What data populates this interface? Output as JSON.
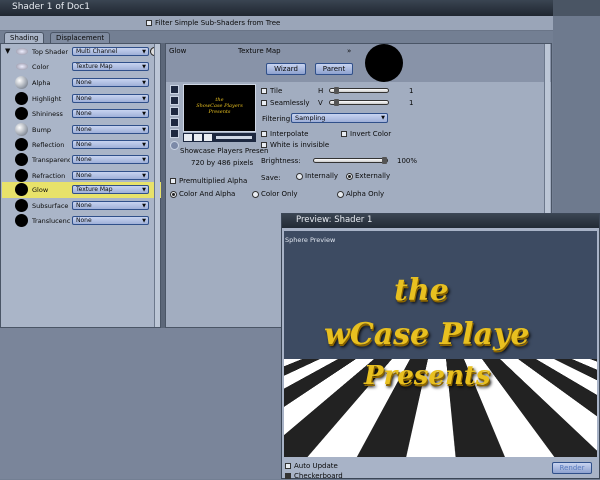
{
  "window": {
    "title": "Shader 1 of Doc1"
  },
  "toolbar": {
    "filter_label": "Filter Simple Sub-Shaders from Tree"
  },
  "tabs": [
    {
      "label": "Shading"
    },
    {
      "label": "Displacement"
    }
  ],
  "channels": [
    {
      "label": "Top Shader",
      "value": "Multi Channel"
    },
    {
      "label": "Color",
      "value": "Texture Map"
    },
    {
      "label": "Alpha",
      "value": "None"
    },
    {
      "label": "Highlight",
      "value": "None"
    },
    {
      "label": "Shininess",
      "value": "None"
    },
    {
      "label": "Bump",
      "value": "None"
    },
    {
      "label": "Reflection",
      "value": "None"
    },
    {
      "label": "Transparency",
      "value": "None"
    },
    {
      "label": "Refraction",
      "value": "None"
    },
    {
      "label": "Glow",
      "value": "Texture Map"
    },
    {
      "label": "Subsurface Sc",
      "value": "None"
    },
    {
      "label": "Translucency",
      "value": "None"
    }
  ],
  "right": {
    "channel_name": "Glow",
    "shader_type": "Texture Map",
    "wizard": "Wizard",
    "parent": "Parent",
    "thumb_text": [
      "the",
      "ShowCase Players",
      "Presents"
    ],
    "image_name": "Showcase Players Presen",
    "image_size": "720 by 486 pixels",
    "tile": {
      "label": "Tile",
      "axis": "H",
      "value": "1"
    },
    "seamless": {
      "label": "Seamlessly",
      "axis": "V",
      "value": "1"
    },
    "filtering": {
      "label": "Filtering:",
      "value": "Sampling"
    },
    "interpolate": "Interpolate",
    "invert": "Invert Color",
    "white_invisible": "White is invisible",
    "brightness": {
      "label": "Brightness:",
      "value": "100%",
      "level": 1.0
    },
    "save": {
      "label": "Save:",
      "opt1": "Internally",
      "opt2": "Externally"
    },
    "premult": "Premultiplied Alpha",
    "modes": [
      "Color And Alpha",
      "Color Only",
      "Alpha Only"
    ]
  },
  "preview": {
    "title": "Preview: Shader 1",
    "area_label": "Sphere Preview",
    "text_lines": [
      "the",
      "wCase Playe",
      "Presents"
    ],
    "auto_update": "Auto Update",
    "checkerboard": "Checkerboard",
    "render": "Render"
  }
}
